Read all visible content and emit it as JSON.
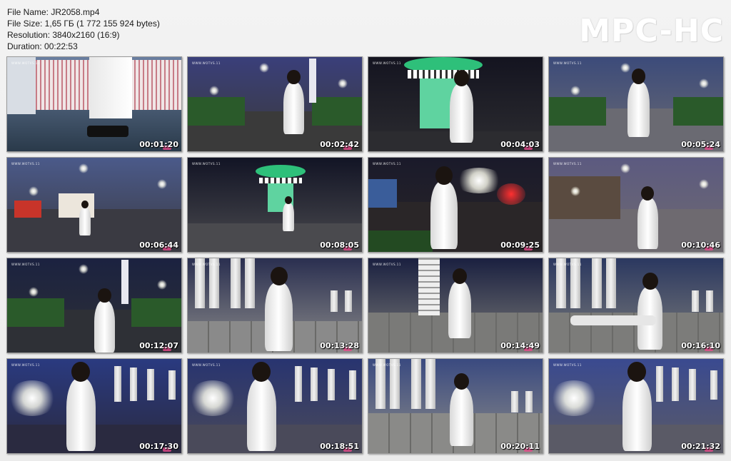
{
  "file_info": {
    "name_line": "File Name: JR2058.mp4",
    "size_line": "File Size: 1,65 ГБ (1 772 155 924 bytes)",
    "resolution_line": "Resolution: 3840x2160 (16:9)",
    "duration_line": "Duration: 00:22:53"
  },
  "logo_text": "MPC-HC",
  "watermark_text": "WWW.WOTVS.11",
  "thumbnails": [
    {
      "time": "00:01:20",
      "scene": "indoor-sofa",
      "sky": "#6a7fa0",
      "ground": "#2a3a4a"
    },
    {
      "time": "00:02:42",
      "scene": "path-night",
      "sky": "#3a3f7a",
      "ground": "#3a3a3a"
    },
    {
      "time": "00:04:03",
      "scene": "kiosk-green",
      "sky": "#141420",
      "ground": "#2c2c30"
    },
    {
      "time": "00:05:24",
      "scene": "plaza-walk",
      "sky": "#3c4b7a",
      "ground": "#6a6a72"
    },
    {
      "time": "00:06:44",
      "scene": "plaza-wide",
      "sky": "#4b5a8a",
      "ground": "#3a3a42"
    },
    {
      "time": "00:08:05",
      "scene": "kiosk-wide",
      "sky": "#121425",
      "ground": "#4a4a4e"
    },
    {
      "time": "00:09:25",
      "scene": "street-night",
      "sky": "#1a1a2a",
      "ground": "#2a2628"
    },
    {
      "time": "00:10:46",
      "scene": "plaza-dusk",
      "sky": "#5c5a80",
      "ground": "#6e6a70"
    },
    {
      "time": "00:12:07",
      "scene": "monument-night",
      "sky": "#1b2240",
      "ground": "#2e3036"
    },
    {
      "time": "00:13:28",
      "scene": "pillars-close",
      "sky": "#2a2f50",
      "ground": "#8a8a8a"
    },
    {
      "time": "00:14:49",
      "scene": "wall-sit",
      "sky": "#1a2040",
      "ground": "#7a7a78"
    },
    {
      "time": "00:16:10",
      "scene": "wall-two",
      "sky": "#2b3860",
      "ground": "#7c7c7a"
    },
    {
      "time": "00:17:30",
      "scene": "portrait-pillars",
      "sky": "#2a3a80",
      "ground": "#2a2a40"
    },
    {
      "time": "00:18:51",
      "scene": "portrait-lights",
      "sky": "#283470",
      "ground": "#4a4a5a"
    },
    {
      "time": "00:20:11",
      "scene": "wall-stand",
      "sky": "#3a4a80",
      "ground": "#8a8a88"
    },
    {
      "time": "00:21:32",
      "scene": "portrait-bay",
      "sky": "#3a4a90",
      "ground": "#5a5a66"
    }
  ]
}
